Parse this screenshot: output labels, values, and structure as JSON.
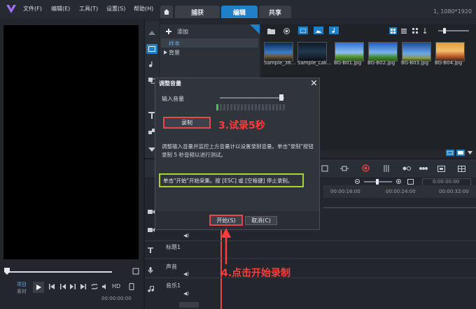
{
  "menubar": {
    "items": [
      "文件(F)",
      "编辑(E)",
      "工具(T)",
      "设置(S)",
      "帮助(H)"
    ],
    "tabs": [
      "捕获",
      "编辑",
      "共享"
    ],
    "resolution": "1, 1080*1920"
  },
  "library": {
    "add_label": "添加",
    "tree_items": [
      "样本",
      "背景"
    ],
    "thumbnails": [
      "Sample_36...",
      "Sample_Lak...",
      "BG-B01.jpg",
      "BG-B02.jpg",
      "BG-B03.jpg",
      "BG-B04.jpg"
    ]
  },
  "preview": {
    "project_label": "项目",
    "material_label": "素材",
    "hd_label": "HD",
    "timecode": "00:00:00:00"
  },
  "timeline": {
    "ruler_times": [
      "00:00:16:00",
      "00:00:24:00",
      "00:00:32:00"
    ],
    "timecode": "0:00:00:00",
    "tracks": [
      "标题1",
      "声音",
      "音乐1"
    ]
  },
  "dialog": {
    "title": "调整音量",
    "input_label": "输入音量",
    "record_button": "录制",
    "description": "调整输入音量并监控上方音量计以设置录制音量。单击\"录制\"按钮录制 5 秒音频以进行测试。",
    "start_info": "单击\"开始\"开始采集。按 [ESC] 或 [空格键] 停止录制。",
    "start_button": "开始(S)",
    "cancel_button": "取消(C)",
    "input_volume_level": 0.92,
    "meter_active_segments": 1
  },
  "annotations": {
    "step3": "3.试录5秒",
    "step4": "4.点击开始录制"
  },
  "colors": {
    "accent": "#1f80c8",
    "highlight_red": "#e94848",
    "highlight_green": "#a8d43a",
    "annotation_red": "#ff3b3b"
  }
}
